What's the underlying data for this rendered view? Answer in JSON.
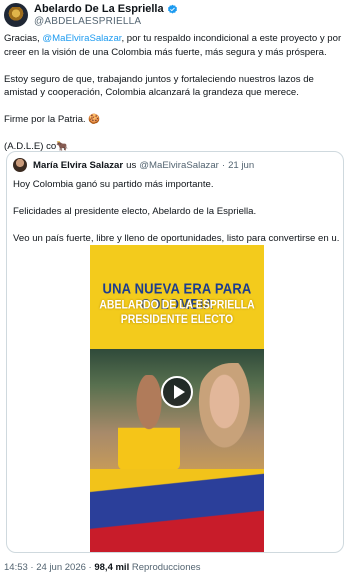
{
  "author": {
    "name": "Abelardo De La Espriella",
    "handle": "@ABDELAESPRIELLA"
  },
  "tweet": {
    "p1_before": "Gracias, ",
    "p1_mention": "@MaElviraSalazar",
    "p1_after": ", por tu respaldo incondicional a este proyecto y por creer en la visión de una Colombia más fuerte, más segura y más próspera.",
    "p2": "Estoy seguro de que, trabajando juntos y fortaleciendo nuestros lazos de amistad y cooperación, Colombia alcanzará la grandeza que merece.",
    "p3": "Firme por la Patria. 🍪",
    "p4": "(A.D.L.E) co🐂"
  },
  "quote": {
    "name": "María Elvira Salazar",
    "flag": "us",
    "handle": "@MaElviraSalazar",
    "date": "21 jun",
    "line1": "Hoy Colombia ganó su partido más importante.",
    "line2": "Felicidades al presidente electo, Abelardo de la Espriella.",
    "line3": "Veo un país fuerte, libre y lleno de oportunidades, listo para convertirse en u..."
  },
  "video": {
    "title": "UNA NUEVA ERA PARA COLOMBIA",
    "subtitle_line1": "ABELARDO DE LA ESPRIELLA",
    "subtitle_line2": "PRESIDENTE ELECTO"
  },
  "footer": {
    "time": "14:53",
    "date": "24 jun 2026",
    "views": "98,4 mil",
    "views_label": "Reproducciones"
  },
  "colors": {
    "accent": "#1d9bf0",
    "secondary_text": "#536471",
    "border": "#cfd9de"
  }
}
